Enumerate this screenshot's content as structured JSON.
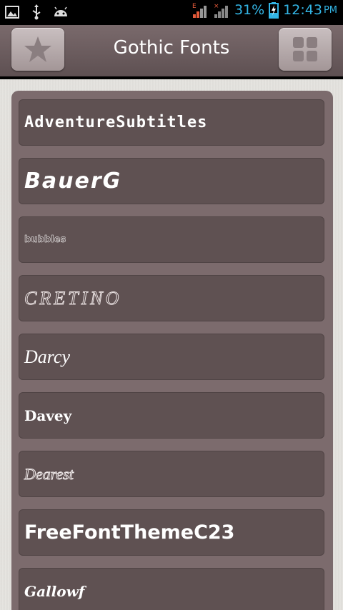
{
  "status_bar": {
    "battery": "31%",
    "time": "12:43",
    "ampm": "PM",
    "network_label": "E",
    "accent": "#33b5e5"
  },
  "action_bar": {
    "title": "Gothic Fonts",
    "left_icon": "star-icon",
    "right_icon": "grid-icon"
  },
  "fonts": [
    {
      "label": "AdventureSubtitles"
    },
    {
      "label": "BauerG"
    },
    {
      "label": "bubbles"
    },
    {
      "label": "CRETINO"
    },
    {
      "label": "Darcy"
    },
    {
      "label": "Davey"
    },
    {
      "label": "Dearest"
    },
    {
      "label": "FreeFontThemeC23"
    },
    {
      "label": "Gallowf"
    }
  ]
}
